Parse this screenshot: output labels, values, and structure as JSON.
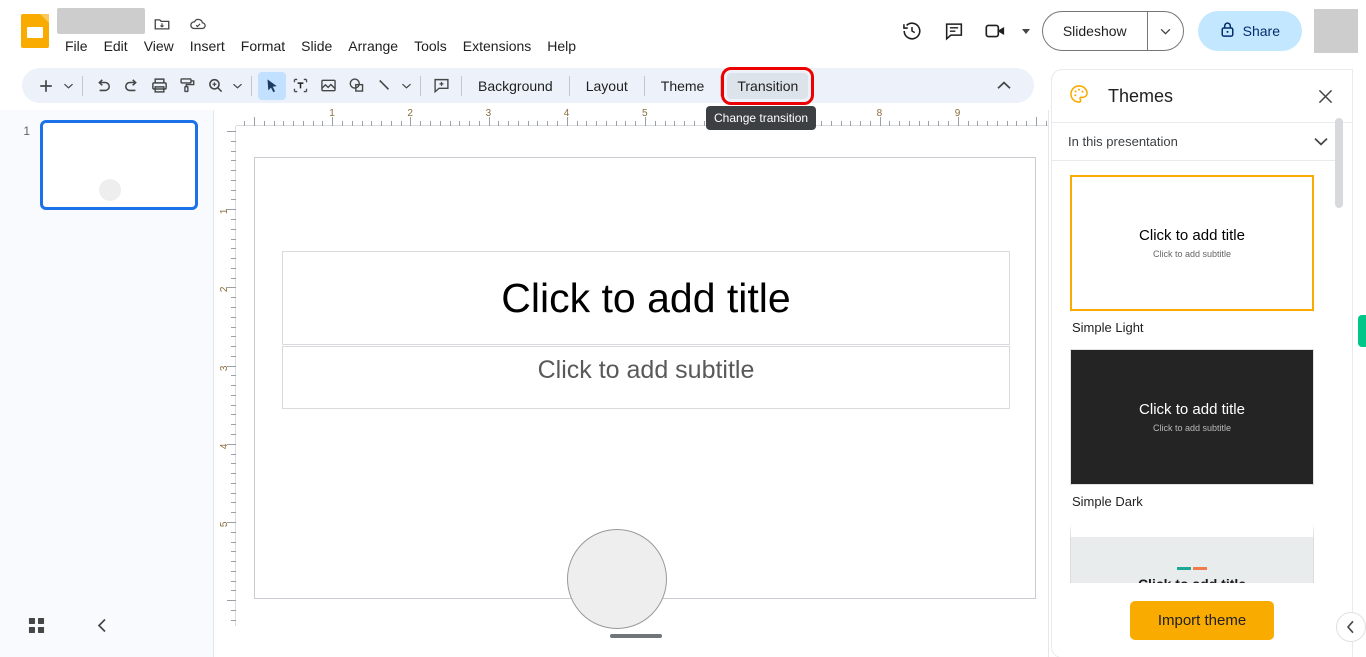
{
  "app": {
    "name": "Google Slides",
    "logo_icon": "slides-logo-icon",
    "document_title": "",
    "title_icons": [
      {
        "name": "move-to-folder-icon",
        "label": "Move"
      },
      {
        "name": "cloud-saved-icon",
        "label": "Saved to Drive"
      }
    ]
  },
  "menubar": {
    "items": [
      {
        "label": "File"
      },
      {
        "label": "Edit"
      },
      {
        "label": "View"
      },
      {
        "label": "Insert"
      },
      {
        "label": "Format"
      },
      {
        "label": "Slide"
      },
      {
        "label": "Arrange"
      },
      {
        "label": "Tools"
      },
      {
        "label": "Extensions"
      },
      {
        "label": "Help"
      }
    ]
  },
  "topright": {
    "history_icon": "version-history-icon",
    "comment_icon": "comment-icon",
    "meet_icon": "meet-camera-icon",
    "slideshow_label": "Slideshow",
    "slideshow_caret_icon": "chevron-down-icon",
    "share_label": "Share",
    "share_lock_icon": "lock-icon"
  },
  "toolbar": {
    "new_slide_icon": "add-slide-icon",
    "new_slide_caret_icon": "chevron-down-icon",
    "undo_icon": "undo-icon",
    "redo_icon": "redo-icon",
    "print_icon": "print-icon",
    "paint_format_icon": "paint-format-icon",
    "zoom_icon": "zoom-icon",
    "zoom_caret_icon": "chevron-down-icon",
    "select_icon": "select-cursor-icon",
    "textbox_icon": "text-box-icon",
    "image_icon": "insert-image-icon",
    "shape_icon": "insert-shape-icon",
    "line_icon": "insert-line-icon",
    "line_caret_icon": "chevron-down-icon",
    "comment_icon": "add-comment-icon",
    "background_label": "Background",
    "layout_label": "Layout",
    "theme_label": "Theme",
    "transition_label": "Transition",
    "collapse_icon": "chevron-up-icon",
    "tooltip_text": "Change transition"
  },
  "filmstrip": {
    "slides": [
      {
        "number": "1",
        "selected": true
      }
    ],
    "grid_view_icon": "grid-view-icon",
    "collapse_icon": "chevron-left-icon"
  },
  "rulers": {
    "horizontal_labels": [
      "1",
      "2",
      "3",
      "4",
      "5",
      "6",
      "7",
      "8",
      "9"
    ],
    "vertical_labels": [
      "1",
      "2",
      "3",
      "4",
      "5"
    ],
    "unit": "inches"
  },
  "canvas": {
    "title_placeholder": "Click to add title",
    "subtitle_placeholder": "Click to add subtitle",
    "shape": {
      "name": "circle-shape",
      "fill": "#eeeeee",
      "stroke": "#999999"
    }
  },
  "themes_panel": {
    "title": "Themes",
    "palette_icon": "palette-icon",
    "close_icon": "close-icon",
    "filter_label": "In this presentation",
    "filter_caret_icon": "chevron-down-icon",
    "themes": [
      {
        "label": "Simple Light",
        "selected": true,
        "title_text": "Click to add title",
        "subtitle_text": "Click to add subtitle",
        "style": "light"
      },
      {
        "label": "Simple Dark",
        "selected": false,
        "title_text": "Click to add title",
        "subtitle_text": "Click to add subtitle",
        "style": "dark"
      },
      {
        "label": "",
        "selected": false,
        "title_text": "Click to add title",
        "subtitle_text": "",
        "style": "accent",
        "accent_colors": [
          "#1aa897",
          "#ef7c4d"
        ]
      }
    ],
    "import_label": "Import theme"
  },
  "edge": {
    "green_tab_color": "#00c689",
    "collapse_icon": "chevron-left-icon"
  },
  "colors": {
    "brand_yellow": "#f9ab00",
    "accent_blue": "#1b72e8",
    "share_blue": "#c2e7ff",
    "toolbar_bg": "#edf2fa",
    "highlight_red": "#ee0000",
    "tooltip_bg": "#3c4043"
  }
}
